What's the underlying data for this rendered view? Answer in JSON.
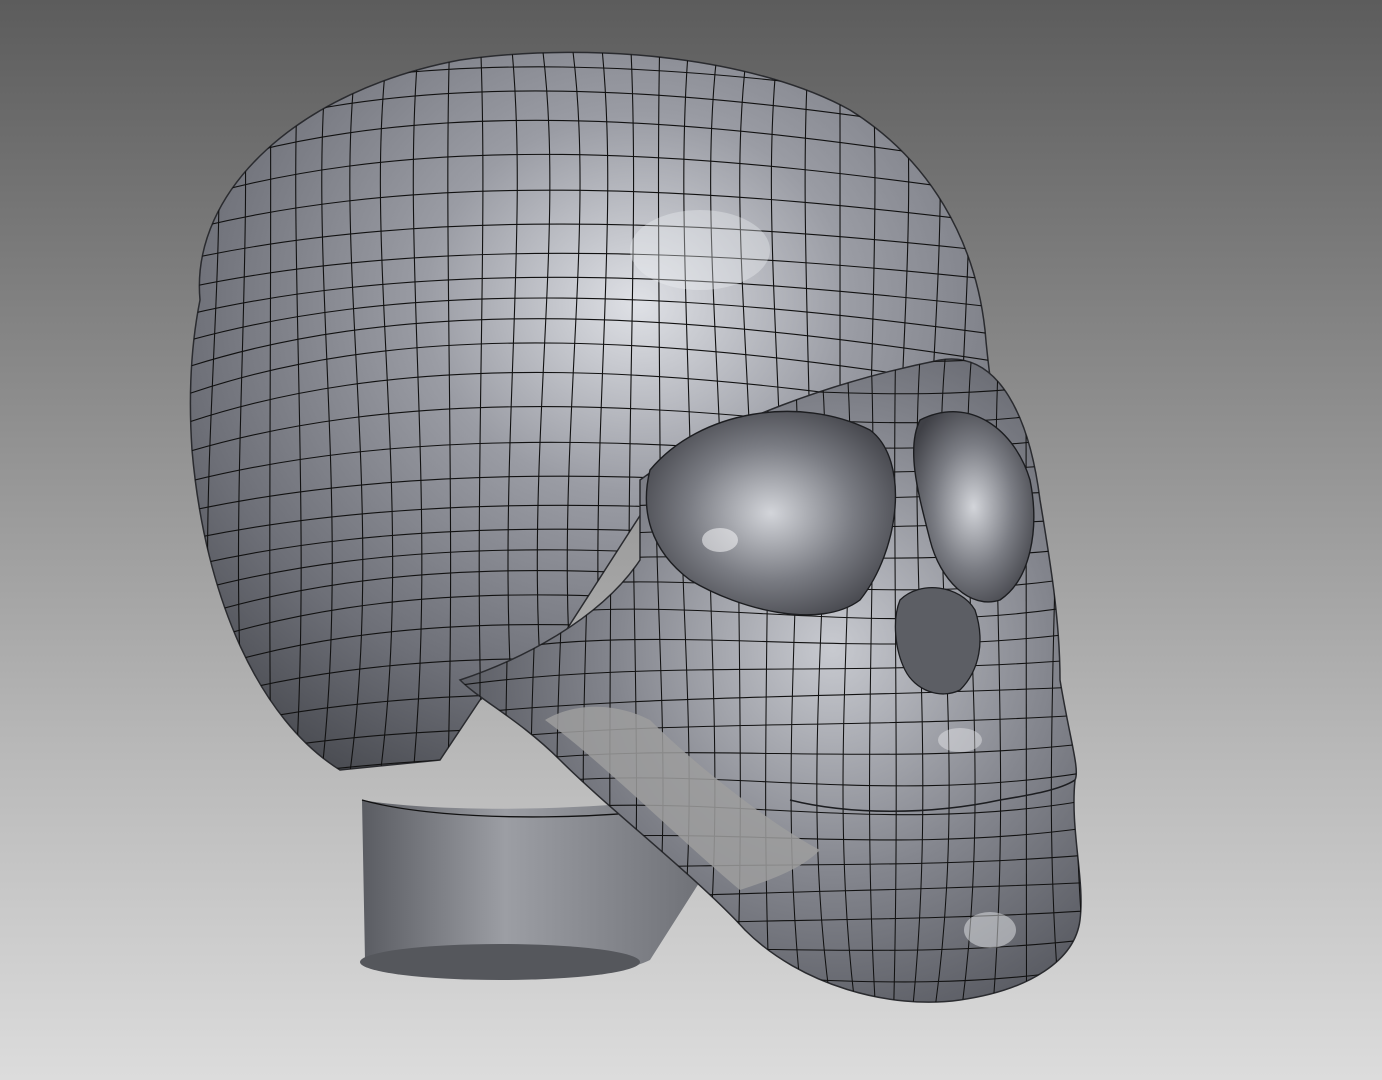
{
  "viewport": {
    "background_top": "#5c5c5c",
    "background_bottom": "#dcdcdc"
  },
  "model": {
    "type": "skull-mesh",
    "surface_color": "#7d7f87",
    "wire_color": "#111111",
    "highlight_color": "#e9ebef"
  }
}
